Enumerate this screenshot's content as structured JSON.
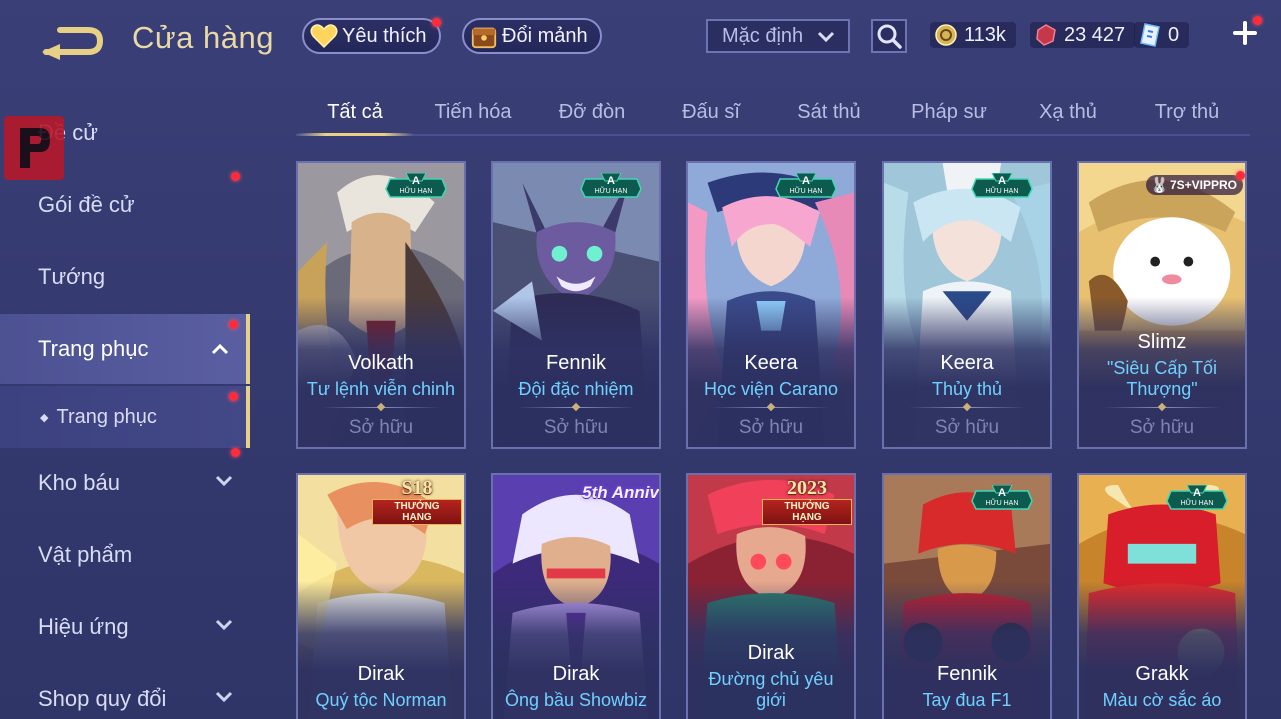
{
  "header": {
    "title": "Cửa hàng",
    "favorites_label": "Yêu thích",
    "exchange_label": "Đổi mảnh",
    "sort_selected": "Mặc định"
  },
  "currency": {
    "gold": "113k",
    "gems": "23 427",
    "vouchers": "0"
  },
  "sidebar": {
    "items": [
      {
        "label": "Đề cử"
      },
      {
        "label": "Gói đề cử"
      },
      {
        "label": "Tướng"
      },
      {
        "label": "Trang phục"
      },
      {
        "label": "Trang phục"
      },
      {
        "label": "Kho báu"
      },
      {
        "label": "Vật phẩm"
      },
      {
        "label": "Hiệu ứng"
      },
      {
        "label": "Shop quy đổi"
      }
    ]
  },
  "tabs": [
    "Tất cả",
    "Tiến hóa",
    "Đỡ đòn",
    "Đấu sĩ",
    "Sát thủ",
    "Pháp sư",
    "Xạ thủ",
    "Trợ thủ"
  ],
  "badges": {
    "limited_tier": "A",
    "limited_label": "HỮU HẠN",
    "s18": "S18",
    "rank_label": "THƯỞNG HẠNG",
    "anniv": "5th Anniv",
    "year_2023": "2023",
    "vip": "7S+VIPPRO"
  },
  "owned_label": "Sở hữu",
  "cards": [
    {
      "hero": "Volkath",
      "skin": "Tư lệnh viễn chinh",
      "owned": "Sở hữu"
    },
    {
      "hero": "Fennik",
      "skin": "Đội đặc nhiệm",
      "owned": "Sở hữu"
    },
    {
      "hero": "Keera",
      "skin": "Học viện Carano",
      "owned": "Sở hữu"
    },
    {
      "hero": "Keera",
      "skin": "Thủy thủ",
      "owned": "Sở hữu"
    },
    {
      "hero": "Slimz",
      "skin": "\"Siêu Cấp Tối Thượng\"",
      "owned": "Sở hữu"
    },
    {
      "hero": "Dirak",
      "skin": "Quý tộc Norman"
    },
    {
      "hero": "Dirak",
      "skin": "Ông bầu Showbiz"
    },
    {
      "hero": "Dirak",
      "skin": "Đường chủ yêu giới"
    },
    {
      "hero": "Fennik",
      "skin": "Tay đua F1"
    },
    {
      "hero": "Grakk",
      "skin": "Màu cờ sắc áo"
    }
  ],
  "colors": {
    "accent_gold": "#e8cf8a",
    "skin_name_blue": "#6fd0ff",
    "notification_red": "#ff2a3a"
  }
}
